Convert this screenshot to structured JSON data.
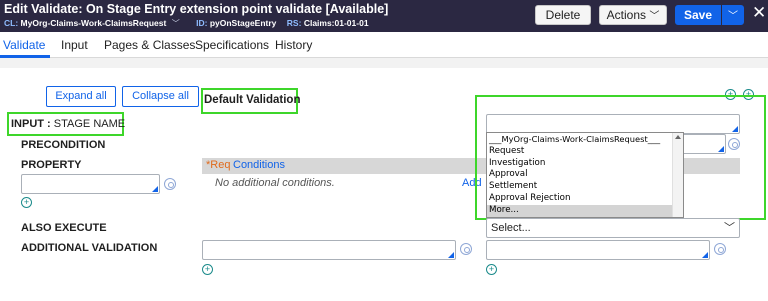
{
  "header": {
    "title": "Edit  Validate: On Stage Entry extension point validate [Available]",
    "cl_label": "CL:",
    "cl_value": "MyOrg-Claims-Work-ClaimsRequest",
    "id_label": "ID:",
    "id_value": "pyOnStageEntry",
    "rs_label": "RS:",
    "rs_value": "Claims:01-01-01",
    "delete_label": "Delete",
    "actions_label": "Actions",
    "save_label": "Save",
    "close_glyph": "✕",
    "accent_color": "#1163e8",
    "bg_color": "#2b2842"
  },
  "tabs": [
    "Validate",
    "Input",
    "Pages & Classes",
    "Specifications",
    "History"
  ],
  "active_tab": "Validate",
  "form": {
    "expand_all": "Expand all",
    "collapse_all": "Collapse all",
    "default_validation": "Default Validation",
    "input_label": "INPUT :",
    "input_value": "STAGE NAME",
    "precondition": "PRECONDITION",
    "property": "PROPERTY",
    "also_execute": "ALSO EXECUTE",
    "additional_validation": "ADDITIONAL VALIDATION",
    "req_marker": "*Req",
    "conditions_link": "Conditions",
    "no_conditions": "No additional conditions.",
    "add_link": "Add",
    "select_placeholder": "Select..."
  },
  "dropdown": {
    "options": [
      "___MyOrg-Claims-Work-ClaimsRequest___",
      "Request",
      "Investigation",
      "Approval",
      "Settlement",
      "Approval Rejection",
      "More..."
    ],
    "selected": "More..."
  },
  "highlight_color": "#3ed62a",
  "icons": [
    "chevron-down-icon",
    "close-icon",
    "gear-icon",
    "plus-circle-icon"
  ]
}
